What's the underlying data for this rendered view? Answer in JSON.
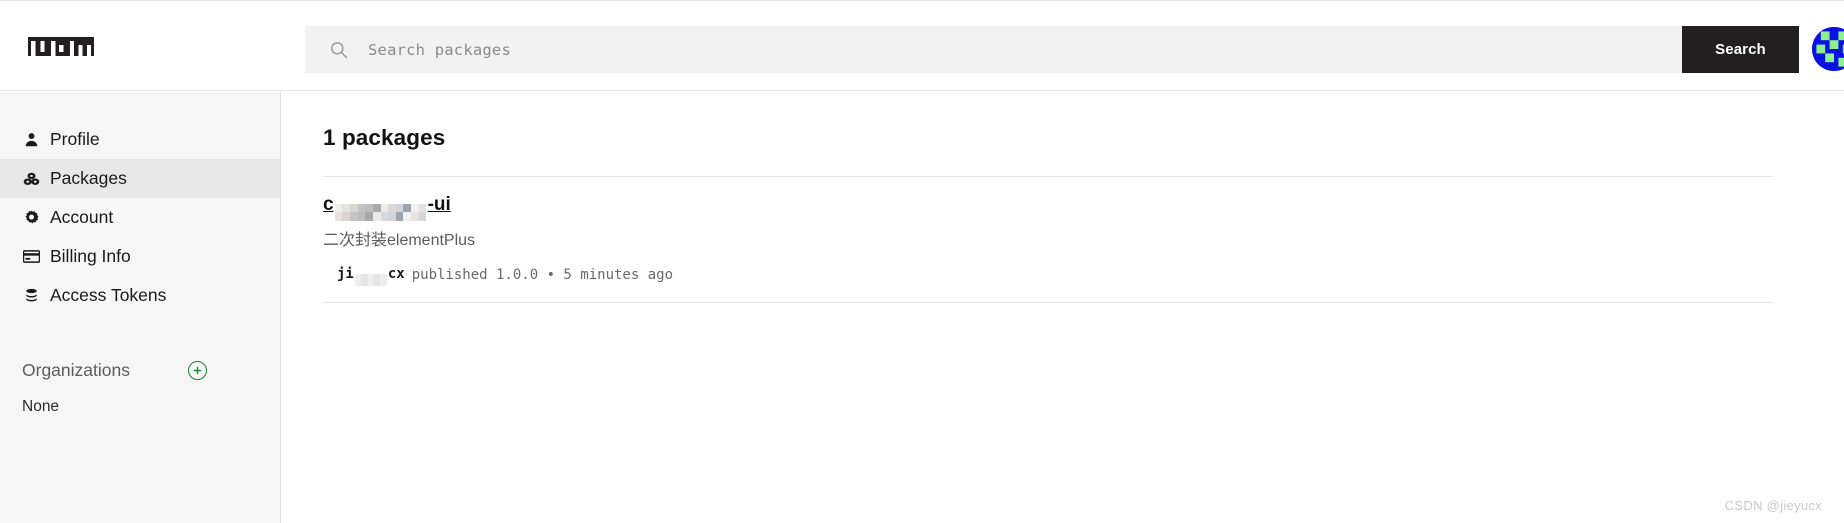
{
  "header": {
    "logo_text": "npm",
    "search": {
      "placeholder": "Search packages",
      "value": "",
      "icon": "search-icon"
    },
    "search_button_label": "Search",
    "avatar_icon": "user-avatar-identicon"
  },
  "sidebar": {
    "items": [
      {
        "label": "Profile",
        "icon": "user-icon",
        "active": false
      },
      {
        "label": "Packages",
        "icon": "packages-icon",
        "active": true
      },
      {
        "label": "Account",
        "icon": "gear-icon",
        "active": false
      },
      {
        "label": "Billing Info",
        "icon": "credit-card-icon",
        "active": false
      },
      {
        "label": "Access Tokens",
        "icon": "tokens-icon",
        "active": false
      }
    ],
    "organizations": {
      "title": "Organizations",
      "add_icon": "plus-circle-icon",
      "empty_label": "None"
    }
  },
  "main": {
    "page_title": "1 packages",
    "packages": [
      {
        "name_prefix": "c",
        "name_redacted": true,
        "name_suffix": "-ui",
        "description": "二次封装elementPlus",
        "author_prefix": "ji",
        "author_redacted": true,
        "author_suffix": "cx",
        "meta": "published 1.0.0 • 5 minutes ago"
      }
    ]
  },
  "watermark": "CSDN @jieyucx",
  "colors": {
    "accent_dark": "#231f20",
    "sidebar_bg": "#f6f6f6",
    "sidebar_active_bg": "#e8e8e8",
    "search_bg": "#f2f2f2",
    "green": "#1d7e38",
    "avatar_blue": "#0b11e0",
    "avatar_green": "#8cf08c",
    "divider": "#e6e6e6",
    "muted_text": "#5c5c5c"
  }
}
